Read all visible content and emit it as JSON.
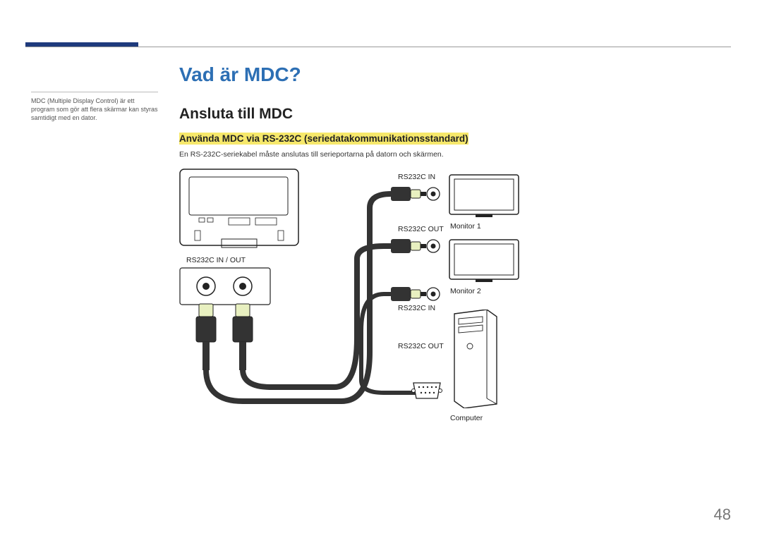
{
  "title": "Vad är MDC?",
  "section": "Ansluta till MDC",
  "subsection": "Använda MDC via RS-232C (seriedatakommunikationsstandard)",
  "body_text": "En RS-232C-seriekabel måste anslutas till serieportarna på datorn och skärmen.",
  "sidebar_note": "MDC (Multiple Display Control) är ett program som gör att flera skärmar kan styras samtidigt med en dator.",
  "labels": {
    "inout": "RS232C IN / OUT",
    "in1": "RS232C IN",
    "out1": "RS232C OUT",
    "in2": "RS232C IN",
    "out2": "RS232C OUT",
    "monitor1": "Monitor 1",
    "monitor2": "Monitor 2",
    "computer": "Computer"
  },
  "page_number": "48"
}
